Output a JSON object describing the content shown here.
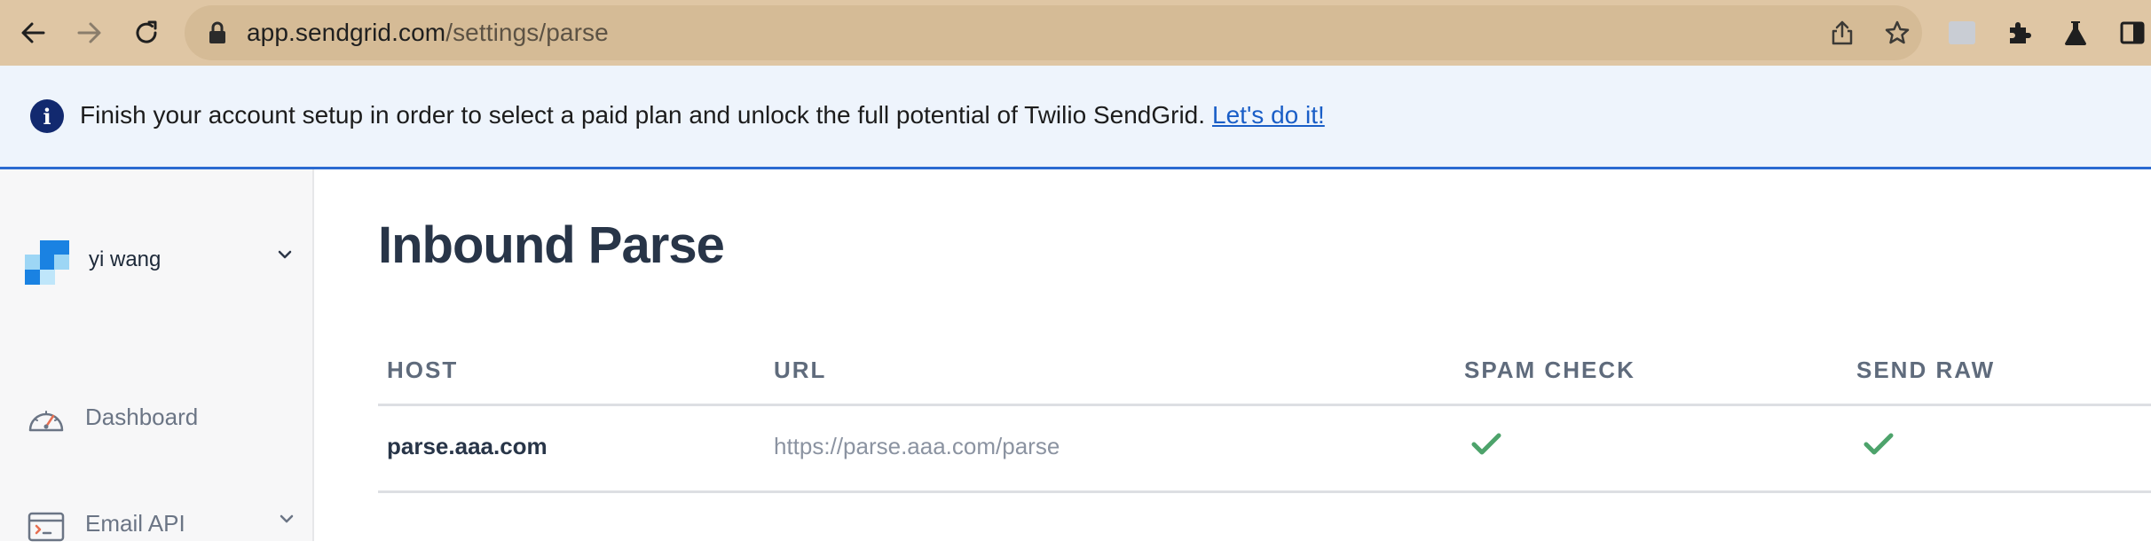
{
  "browser": {
    "url_domain": "app.sendgrid.com",
    "url_path": "/settings/parse",
    "icons": [
      "back-arrow-icon",
      "forward-arrow-icon",
      "reload-icon",
      "lock-icon",
      "share-icon",
      "star-icon",
      "extensions-puzzle-icon",
      "labs-flask-icon",
      "side-panel-icon"
    ]
  },
  "banner": {
    "message": "Finish your account setup in order to select a paid plan and unlock the full potential of Twilio SendGrid.",
    "link_label": "Let's do it!",
    "icon": "info-icon",
    "accent_color": "#2a6ad1"
  },
  "sidebar": {
    "account_name": "yi wang",
    "items": [
      {
        "label": "Dashboard",
        "icon": "gauge-icon"
      },
      {
        "label": "Email API",
        "icon": "terminal-window-icon"
      }
    ]
  },
  "main": {
    "title": "Inbound Parse",
    "table": {
      "headers": [
        "HOST",
        "URL",
        "SPAM CHECK",
        "SEND RAW"
      ],
      "rows": [
        {
          "host": "parse.aaa.com",
          "url": "https://parse.aaa.com/parse",
          "spam_check": true,
          "send_raw": true
        }
      ],
      "check_color": "#4da36b"
    }
  }
}
